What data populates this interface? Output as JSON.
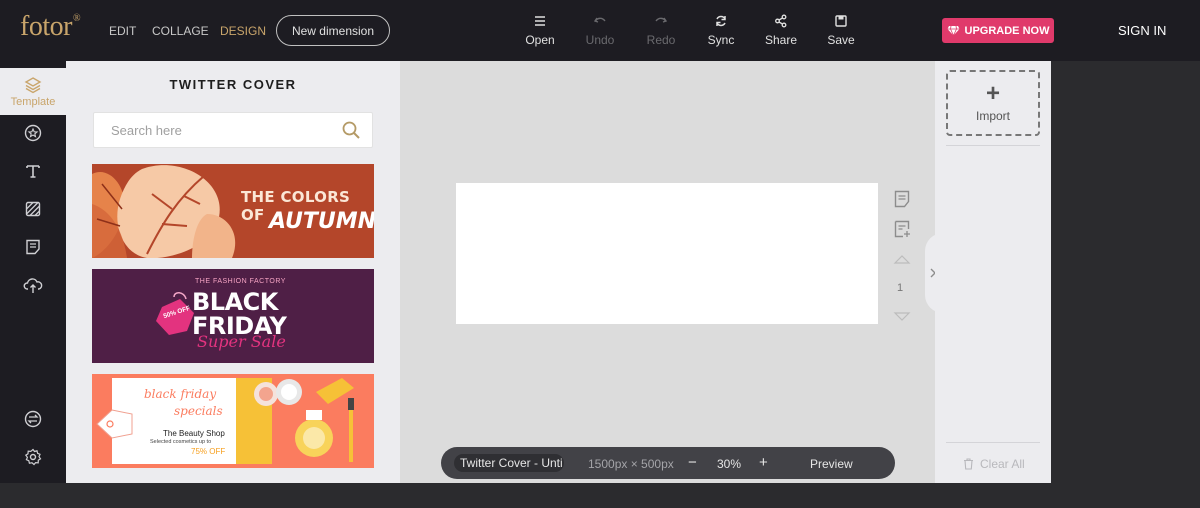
{
  "header": {
    "logo": "fotor",
    "logo_mark": "®",
    "nav": [
      "EDIT",
      "COLLAGE",
      "DESIGN"
    ],
    "new_dimension": "New dimension",
    "tools": [
      {
        "label": "Open",
        "icon": "menu-icon"
      },
      {
        "label": "Undo",
        "icon": "undo-icon"
      },
      {
        "label": "Redo",
        "icon": "redo-icon"
      },
      {
        "label": "Sync",
        "icon": "sync-icon"
      },
      {
        "label": "Share",
        "icon": "share-icon"
      },
      {
        "label": "Save",
        "icon": "save-icon"
      }
    ],
    "upgrade": "UPGRADE NOW",
    "signin": "SIGN IN"
  },
  "rail": {
    "active_label": "Template"
  },
  "panel": {
    "title": "TWITTER COVER",
    "search_placeholder": "Search here",
    "templates": [
      {
        "line1": "THE COLORS OF",
        "line2": "AUTUMN"
      },
      {
        "small": "THE FASHION FACTORY",
        "line1": "BLACK",
        "line2": "FRIDAY",
        "script": "Super Sale",
        "tag": "50% OFF"
      },
      {
        "script1": "black friday",
        "script2": "specials",
        "shop": "The Beauty Shop",
        "desc": "Selected cosmetics up to",
        "off": "75% OFF"
      }
    ]
  },
  "canvas": {
    "page_number": "1"
  },
  "bottombar": {
    "doc_name": "Twitter Cover - Unti",
    "dimensions": "1500px × 500px",
    "minus": "−",
    "zoom": "30%",
    "plus": "+",
    "preview": "Preview"
  },
  "rpanel": {
    "import": "Import",
    "clear_all": "Clear All"
  },
  "colors": {
    "brand_gold": "#c9a56b",
    "upgrade_pink": "#e03a6b",
    "dark_bg": "#1d1c22"
  }
}
